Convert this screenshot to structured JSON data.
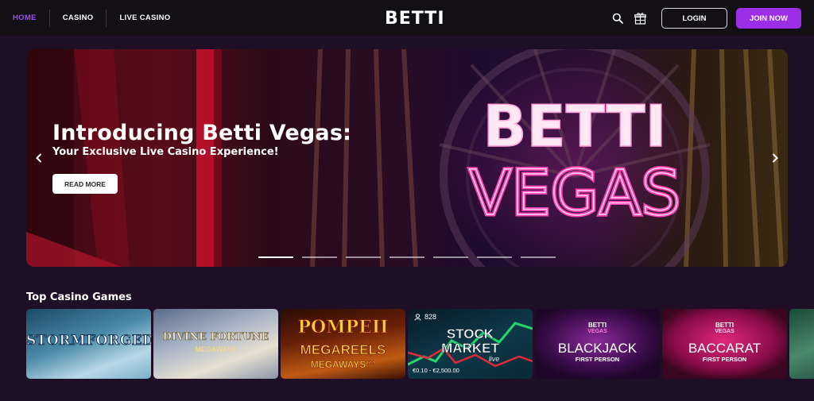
{
  "nav": {
    "items": [
      {
        "label": "HOME",
        "active": true
      },
      {
        "label": "CASINO",
        "active": false
      },
      {
        "label": "LIVE CASINO",
        "active": false
      }
    ]
  },
  "brand": {
    "logo": "BETTI"
  },
  "header": {
    "icons": [
      "search-icon",
      "gift-icon"
    ],
    "login_label": "LOGIN",
    "join_label": "JOIN NOW"
  },
  "colors": {
    "accent": "#9b2ee6",
    "active_nav": "#a04cf0",
    "page_bg": "#1e0f27",
    "header_bg": "#121014"
  },
  "hero": {
    "title": "Introducing Betti Vegas:",
    "subtitle": "Your Exclusive Live Casino Experience!",
    "cta_label": "READ MORE",
    "sign_top": "BETTI",
    "sign_bottom": "VEGAS",
    "slides_count": 7,
    "active_slide": 1
  },
  "section": {
    "title": "Top Casino Games"
  },
  "games": [
    {
      "name": "STORMFORGED",
      "colors": [
        "#2e6e8c",
        "#9cc8d8"
      ]
    },
    {
      "name": "DIVINE FORTUNE",
      "sub": "MEGAWAYS",
      "colors": [
        "#8c9ab0",
        "#d8d4cc"
      ]
    },
    {
      "name": "POMPEII",
      "sub": "MEGAREELS",
      "sub2": "MEGAWAYS™",
      "colors": [
        "#5a1808",
        "#c85a18"
      ]
    },
    {
      "name": "STOCK",
      "sub": "MARKET",
      "sub2": "live",
      "players": "828",
      "limits": "€0.10 - €2,500.00",
      "colors": [
        "#0c2a3a",
        "#1a5a6a"
      ]
    },
    {
      "name": "BLACKJACK",
      "brand_top": "BETTI",
      "brand_mid": "VEGAS",
      "sub": "FIRST PERSON",
      "colors": [
        "#3a0c4a",
        "#6a1a7a"
      ]
    },
    {
      "name": "BACCARAT",
      "brand_top": "BETTI",
      "brand_mid": "VEGAS",
      "sub": "FIRST PERSON",
      "colors": [
        "#5a0c3a",
        "#b81a6a"
      ]
    }
  ]
}
